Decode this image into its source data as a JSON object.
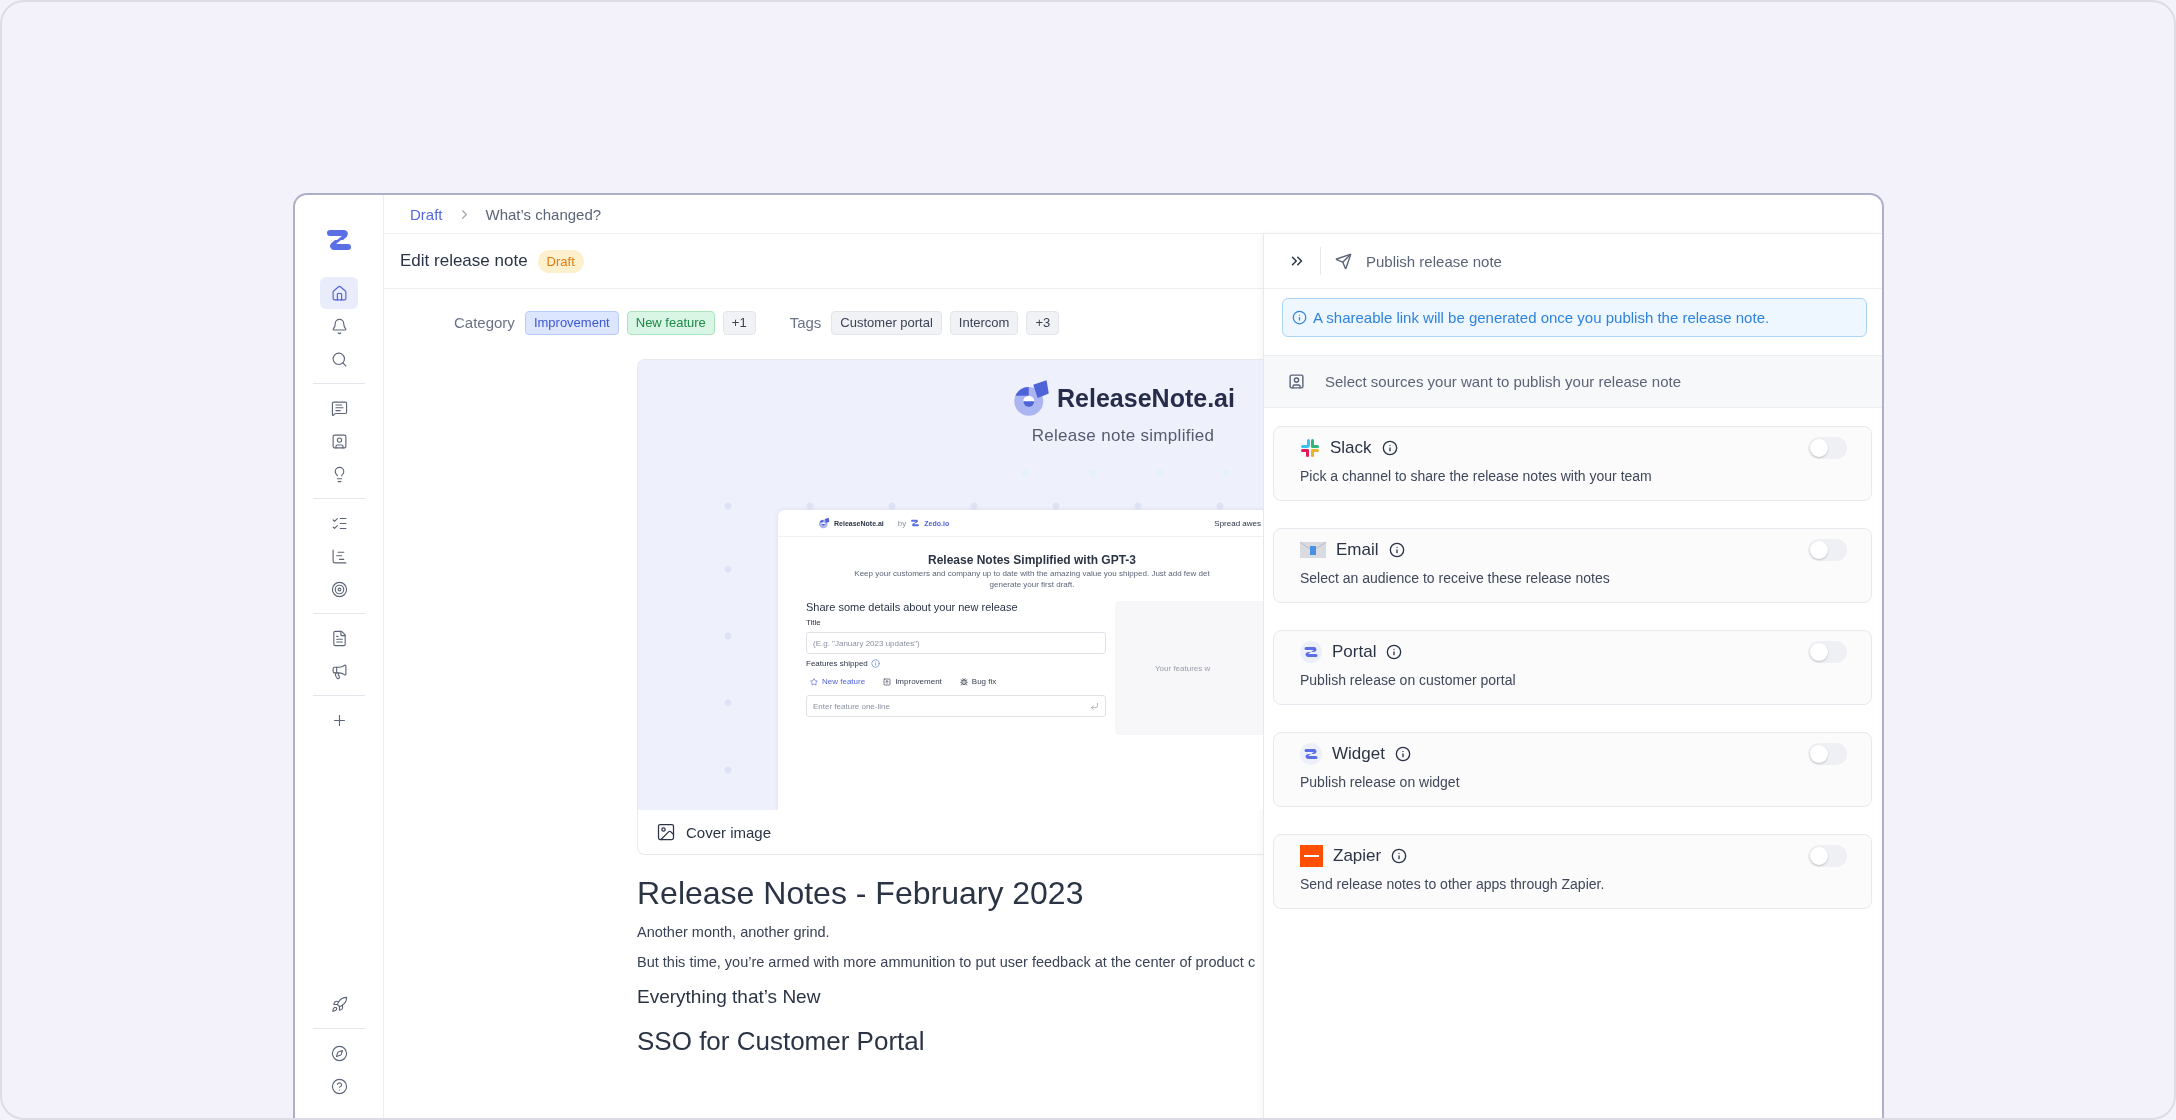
{
  "sidebar": {
    "groups": [
      [
        {
          "selected": true
        },
        {
          "selected": false
        },
        {
          "selected": false
        }
      ],
      [
        {
          "selected": false
        },
        {
          "selected": false
        },
        {
          "selected": false
        }
      ],
      [
        {
          "selected": false
        },
        {
          "selected": false
        },
        {
          "selected": false
        }
      ],
      [
        {
          "selected": false
        },
        {
          "selected": false
        }
      ],
      [
        {
          "selected": false
        }
      ]
    ],
    "bottom": [
      [
        {
          "selected": false
        }
      ],
      [
        {
          "selected": false
        },
        {
          "selected": false
        }
      ]
    ]
  },
  "breadcrumb": [
    {
      "label": "Draft",
      "kind": "link"
    },
    {
      "label": "What’s changed?",
      "kind": "current"
    }
  ],
  "header": {
    "title": "Edit release note",
    "status": "Draft"
  },
  "category": {
    "label": "Category",
    "chips": [
      {
        "label": "Improvement",
        "color": "#dde6ff"
      },
      {
        "label": "New feature",
        "color": "#d9f5e3"
      },
      {
        "label": "+1",
        "color": "#f1f2f5"
      }
    ]
  },
  "tags": {
    "label": "Tags",
    "chips": [
      "Customer portal",
      "Intercom",
      "+3"
    ]
  },
  "cover": {
    "brand": "ReleaseNote.ai",
    "tagline": "Release note simplified",
    "preview": {
      "brand": "ReleaseNote.ai",
      "by": "by",
      "partner": "Zedo.io",
      "nav": "Spread awes",
      "title": "Release Notes Simplified with GPT-3",
      "subtitle": [
        "Keep your customers and company up to date with the amazing value you shipped. Just add few det",
        "generate your first draft."
      ],
      "form_title": "Share some details about your new release",
      "title_label": "Title",
      "title_placeholder": "(E.g. \"January 2023 updates\")",
      "features_label": "Features shipped",
      "feature_types": [
        {
          "label": "New feature",
          "selected": true
        },
        {
          "label": "Improvement",
          "selected": false
        },
        {
          "label": "Bug fix",
          "selected": false
        }
      ],
      "feature_placeholder": "Enter feature one-line",
      "side_text": "Your features w"
    },
    "caption": "Cover image"
  },
  "article": {
    "title": "Release Notes - February 2023",
    "blocks": [
      {
        "kind": "paragraph",
        "text": "Another month, another grind."
      },
      {
        "kind": "paragraph",
        "text": "But this time, you’re armed with more ammunition to put user feedback at the center of product c"
      },
      {
        "kind": "subheading",
        "text": "Everything that’s New"
      },
      {
        "kind": "heading",
        "text": "SSO for Customer Portal"
      }
    ]
  },
  "panel": {
    "title": "Publish release note",
    "notice": "A shareable link will be generated once you publish the release note.",
    "sources_title": "Select sources your want to publish your release note",
    "sources": [
      {
        "kind": "slack",
        "name": "Slack",
        "description": "Pick a channel to share the release notes with your team",
        "on": false
      },
      {
        "kind": "email",
        "name": "Email",
        "description": "Select an audience to receive these release notes",
        "on": false
      },
      {
        "kind": "zedo",
        "name": "Portal",
        "description": "Publish release on customer portal",
        "on": false
      },
      {
        "kind": "zedo",
        "name": "Widget",
        "description": "Publish release on widget",
        "on": false
      },
      {
        "kind": "zapier",
        "name": "Zapier",
        "description": "Send release notes to other apps through Zapier.",
        "on": false
      }
    ]
  }
}
